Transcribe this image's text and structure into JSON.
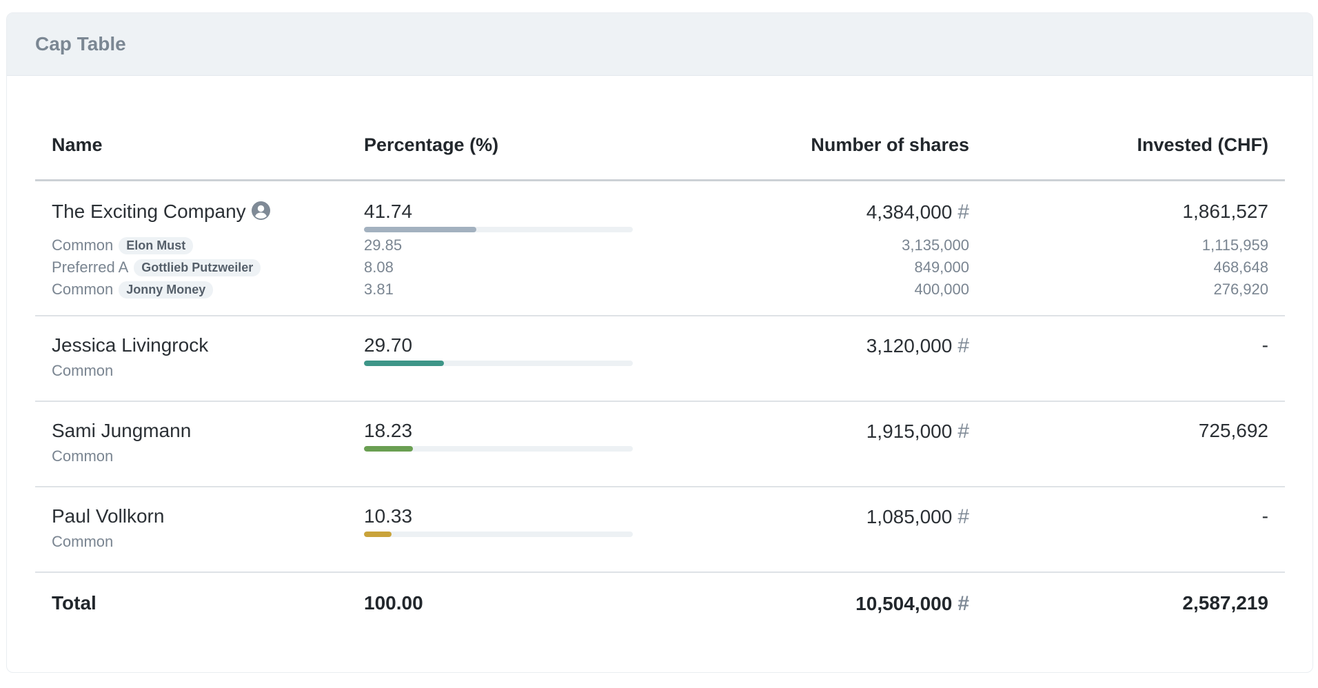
{
  "card": {
    "title": "Cap Table"
  },
  "table": {
    "headers": {
      "name": "Name",
      "percentage": "Percentage (%)",
      "shares": "Number of shares",
      "invested": "Invested (CHF)"
    },
    "rows": [
      {
        "name": "The Exciting Company",
        "icon": "user-circle-icon",
        "percentage": "41.74",
        "bar_fraction": 0.4174,
        "bar_color": "#a3b1bf",
        "shares": "4,384,000",
        "shares_symbol": "#",
        "invested": "1,861,527",
        "sub": [
          {
            "class": "Common",
            "holder": "Elon Must",
            "percentage": "29.85",
            "shares": "3,135,000",
            "invested": "1,115,959"
          },
          {
            "class": "Preferred A",
            "holder": "Gottlieb Putzweiler",
            "percentage": "8.08",
            "shares": "849,000",
            "invested": "468,648"
          },
          {
            "class": "Common",
            "holder": "Jonny Money",
            "percentage": "3.81",
            "shares": "400,000",
            "invested": "276,920"
          }
        ]
      },
      {
        "name": "Jessica Livingrock",
        "class": "Common",
        "percentage": "29.70",
        "bar_fraction": 0.297,
        "bar_color": "#3e9688",
        "shares": "3,120,000",
        "shares_symbol": "#",
        "invested": "-"
      },
      {
        "name": "Sami Jungmann",
        "class": "Common",
        "percentage": "18.23",
        "bar_fraction": 0.1823,
        "bar_color": "#6a9f52",
        "shares": "1,915,000",
        "shares_symbol": "#",
        "invested": "725,692"
      },
      {
        "name": "Paul Vollkorn",
        "class": "Common",
        "percentage": "10.33",
        "bar_fraction": 0.1033,
        "bar_color": "#c9a33a",
        "shares": "1,085,000",
        "shares_symbol": "#",
        "invested": "-"
      }
    ],
    "total": {
      "label": "Total",
      "percentage": "100.00",
      "shares": "10,504,000",
      "shares_symbol": "#",
      "invested": "2,587,219"
    }
  }
}
